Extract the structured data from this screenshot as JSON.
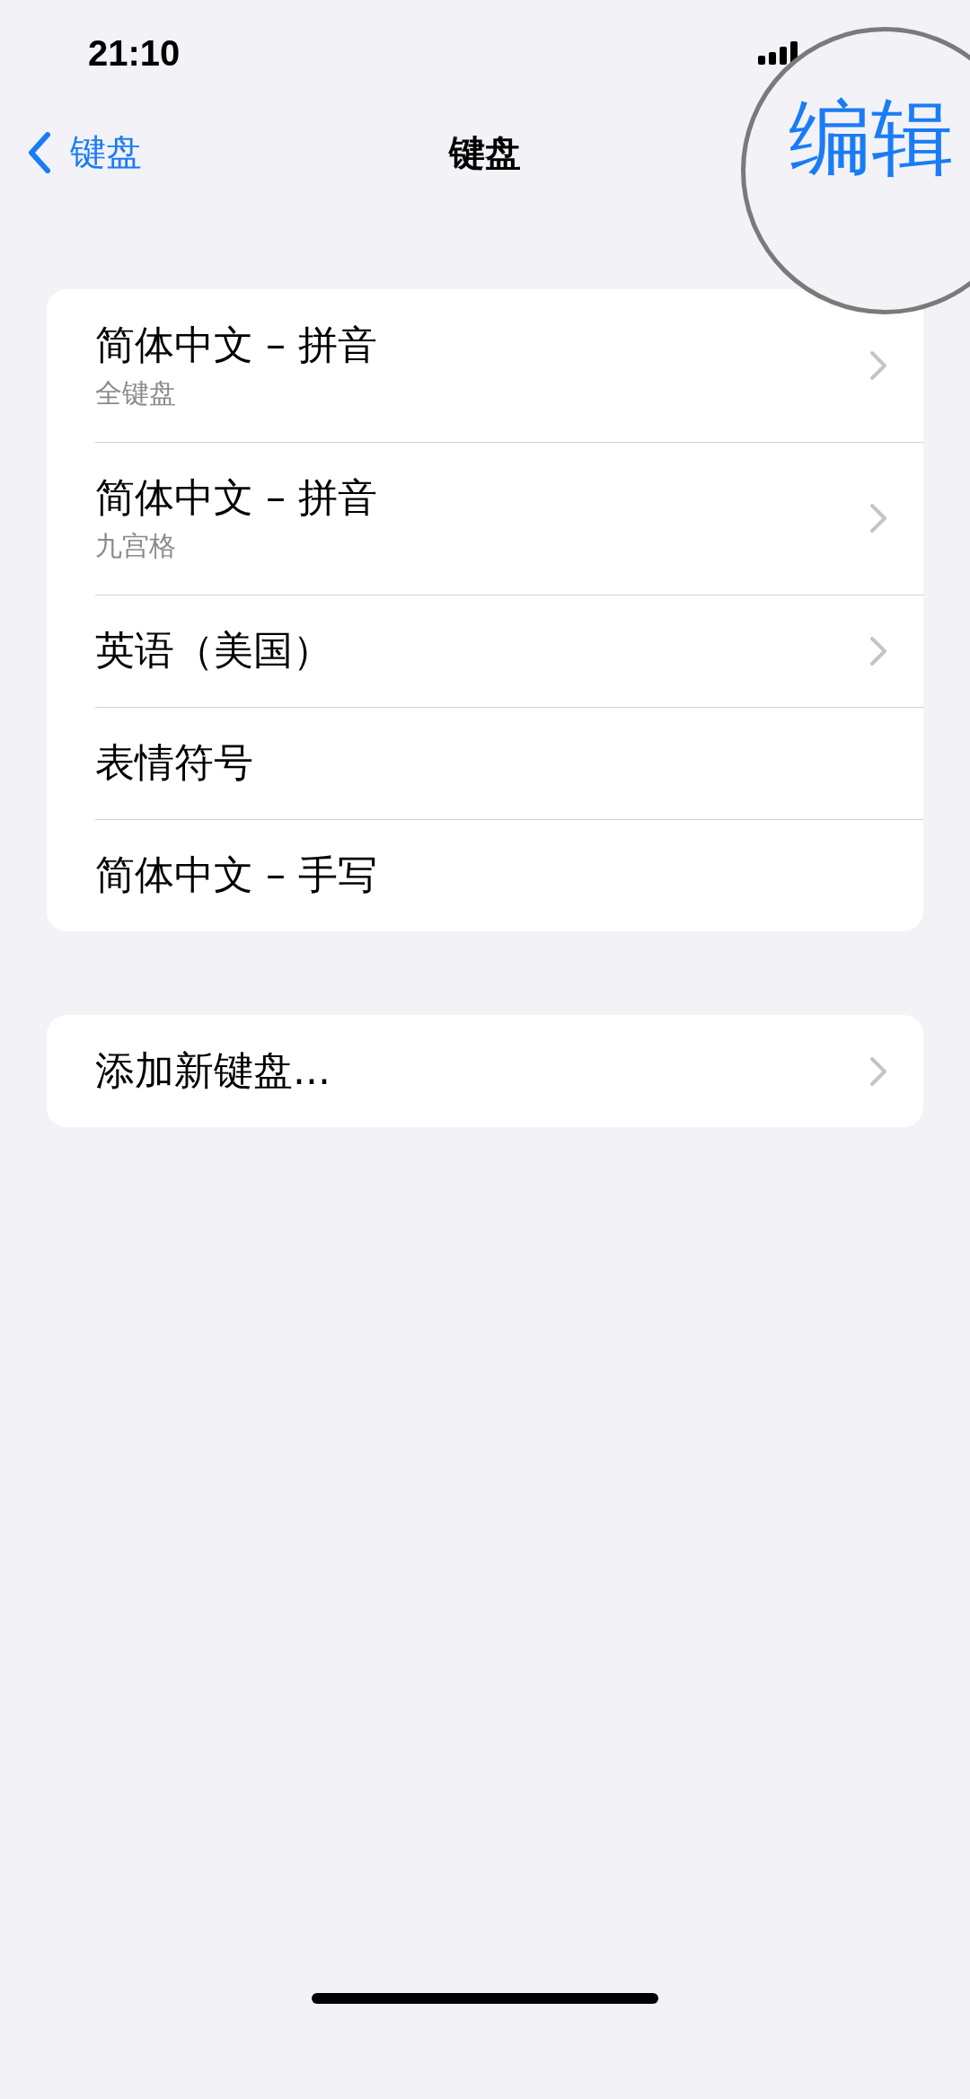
{
  "status_bar": {
    "time": "21:10"
  },
  "nav": {
    "back_label": "键盘",
    "title": "键盘"
  },
  "magnifier": {
    "text": "编辑"
  },
  "groups": [
    {
      "rows": [
        {
          "title": "简体中文 – 拼音",
          "subtitle": "全键盘",
          "disclosure": true
        },
        {
          "title": "简体中文 – 拼音",
          "subtitle": "九宫格",
          "disclosure": true
        },
        {
          "title": "英语（美国）",
          "disclosure": true
        },
        {
          "title": "表情符号",
          "disclosure": false
        },
        {
          "title": "简体中文 – 手写",
          "disclosure": false
        }
      ]
    },
    {
      "rows": [
        {
          "title": "添加新键盘...",
          "disclosure": true
        }
      ]
    }
  ]
}
